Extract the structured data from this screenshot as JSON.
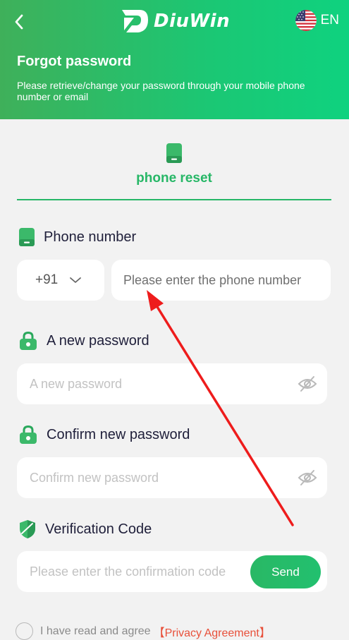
{
  "header": {
    "back_icon": "chevron-left-icon",
    "brand_name": "DiuWin",
    "language": "EN",
    "title": "Forgot password",
    "subtitle": "Please retrieve/change your password through your mobile phone number or email"
  },
  "tab": {
    "label": "phone reset",
    "icon": "phone-icon"
  },
  "phone": {
    "label": "Phone number",
    "country_code": "+91",
    "placeholder": "Please enter the phone number"
  },
  "new_password": {
    "label": "A new password",
    "placeholder": "A new password"
  },
  "confirm_password": {
    "label": "Confirm new password",
    "placeholder": "Confirm new password"
  },
  "verification": {
    "label": "Verification Code",
    "placeholder": "Please enter the confirmation code",
    "send_label": "Send"
  },
  "agreement": {
    "text": "I have read and agree",
    "link": "【Privacy Agreement】"
  },
  "annotation": {
    "type": "red-arrow",
    "color": "#ee1c1c"
  },
  "colors": {
    "brand_green": "#27b767",
    "header_gradient_start": "#3fb05a",
    "header_gradient_end": "#0fd27f",
    "link_red": "#e8503a"
  }
}
